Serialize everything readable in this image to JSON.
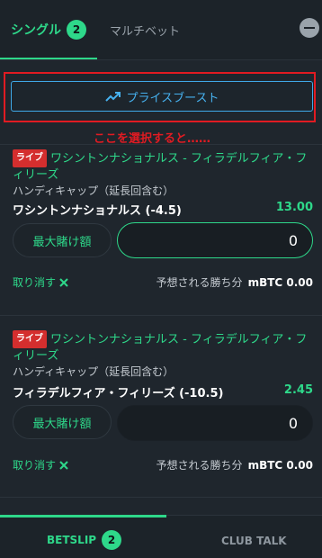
{
  "tabs": {
    "single_label": "シングル",
    "single_count": "2",
    "multi_label": "マルチベット"
  },
  "price_boost": {
    "label": "プライスブースト",
    "icon": "trending-up-icon"
  },
  "annotation": "ここを選択すると……",
  "bets": [
    {
      "live_label": "ライブ",
      "event": "ワシントンナショナルス - フィラデルフィア・フィリーズ",
      "market": "ハンディキャップ（延長回含む）",
      "selection": "ワシントンナショナルス (-4.5)",
      "odds": "13.00",
      "max_bet_label": "最大賭け額",
      "stake_value": "0",
      "cancel_label": "取り消す",
      "winnings_label": "予想される勝ち分",
      "winnings_value": "mBTC 0.00"
    },
    {
      "live_label": "ライブ",
      "event": "ワシントンナショナルス - フィラデルフィア・フィリーズ",
      "market": "ハンディキャップ（延長回含む）",
      "selection": "フィラデルフィア・フィリーズ (-10.5)",
      "odds": "2.45",
      "max_bet_label": "最大賭け額",
      "stake_value": "0",
      "cancel_label": "取り消す",
      "winnings_label": "予想される勝ち分",
      "winnings_value": "mBTC 0.00"
    }
  ],
  "bottom_tabs": {
    "betslip_label": "BETSLIP",
    "betslip_count": "2",
    "club_talk_label": "CLUB TALK"
  },
  "colors": {
    "accent_green": "#2ed88a",
    "highlight_red": "#e11b22",
    "boost_blue": "#46b1ef",
    "background": "#1f262d"
  }
}
